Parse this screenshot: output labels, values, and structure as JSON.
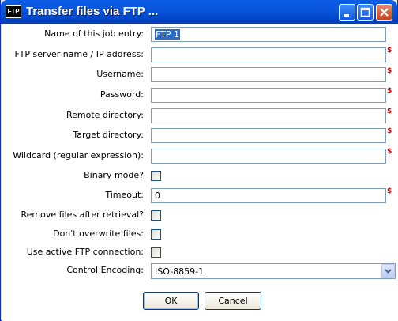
{
  "window": {
    "title": "Transfer files via FTP ...",
    "icon_text": "FTP"
  },
  "form": {
    "job_name": {
      "label": "Name of this job entry:",
      "value": "FTP 1"
    },
    "server": {
      "label": "FTP server name / IP address:",
      "value": ""
    },
    "username": {
      "label": "Username:",
      "value": ""
    },
    "password": {
      "label": "Password:",
      "value": ""
    },
    "remote_dir": {
      "label": "Remote directory:",
      "value": ""
    },
    "target_dir": {
      "label": "Target directory:",
      "value": ""
    },
    "wildcard": {
      "label": "Wildcard (regular expression):",
      "value": ""
    },
    "binary_mode": {
      "label": "Binary mode?",
      "checked": false
    },
    "timeout": {
      "label": "Timeout:",
      "value": "0"
    },
    "remove_files": {
      "label": "Remove files after retrieval?",
      "checked": false
    },
    "dont_overwrite": {
      "label": "Don't overwrite files:",
      "checked": false
    },
    "active_ftp": {
      "label": "Use active FTP connection:",
      "checked": false
    },
    "encoding": {
      "label": "Control Encoding:",
      "value": "ISO-8859-1"
    },
    "variable_marker": "$"
  },
  "buttons": {
    "ok": "OK",
    "cancel": "Cancel"
  },
  "colors": {
    "titlebar": "#0a5ce6",
    "variable_marker": "#d40000",
    "selection": "#316ac5"
  }
}
